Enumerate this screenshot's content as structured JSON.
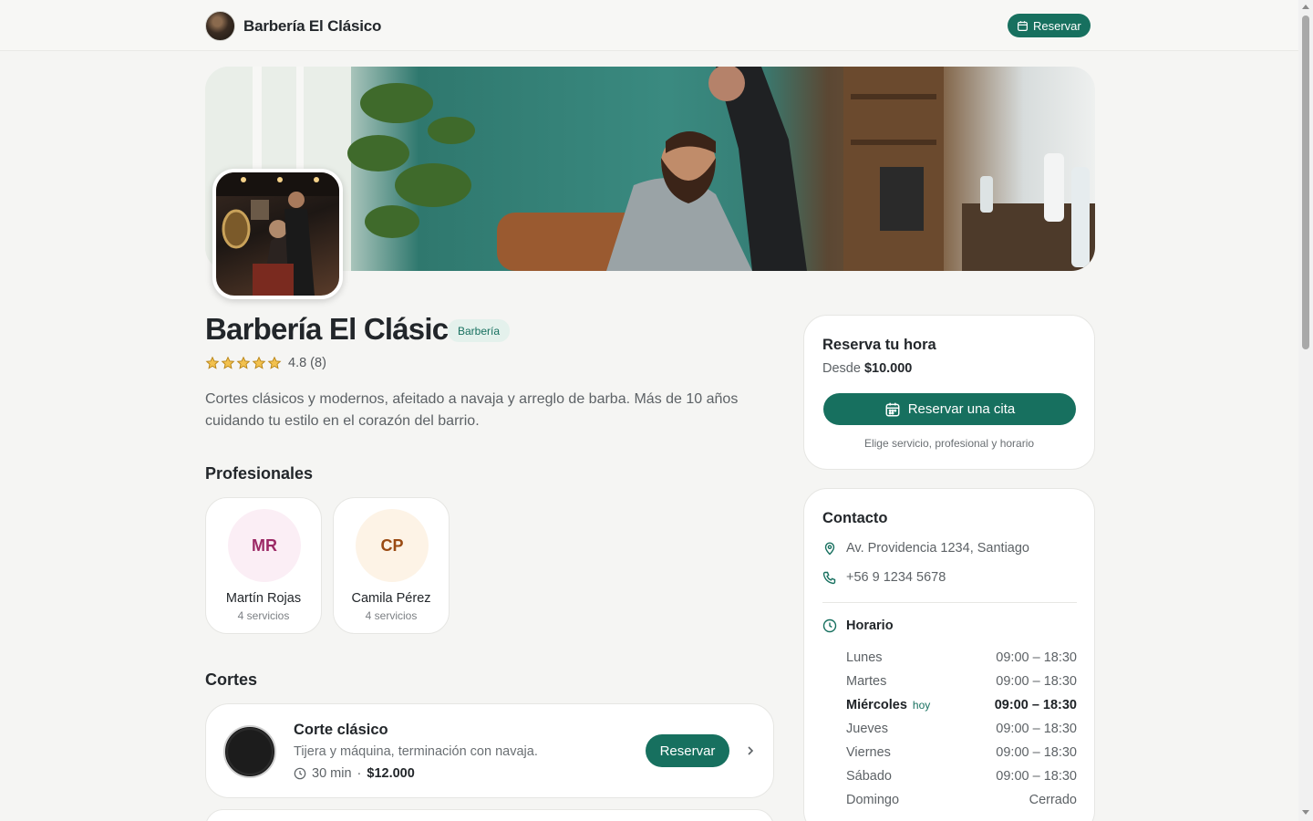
{
  "header": {
    "brand_name": "Barbería El Clásico",
    "reserve_label": "Reservar"
  },
  "shop": {
    "title": "Barbería El Clásico",
    "category": "Barbería",
    "rating_text": "4.8 (8)",
    "rating_value": 4.8,
    "rating_max": 5,
    "description": "Cortes clásicos y modernos, afeitado a navaja y arreglo de barba. Más de 10 años cuidando tu estilo en el corazón del barrio."
  },
  "professionals": {
    "title": "Profesionales",
    "items": [
      {
        "initials": "MR",
        "name": "Martín Rojas",
        "services": "4 servicios",
        "bg": "#fbeef5",
        "fg": "#9c2a66"
      },
      {
        "initials": "CP",
        "name": "Camila Pérez",
        "services": "4 servicios",
        "bg": "#fdf3e6",
        "fg": "#9a4a12"
      }
    ]
  },
  "cuts": {
    "title": "Cortes",
    "items": [
      {
        "name": "Corte clásico",
        "description": "Tijera y máquina, terminación con navaja.",
        "duration": "30 min",
        "separator": "·",
        "price": "$12.000",
        "reserve_label": "Reservar"
      }
    ]
  },
  "booking": {
    "title": "Reserva tu hora",
    "from_label": "Desde",
    "from_price": "$10.000",
    "button_label": "Reservar una cita",
    "hint": "Elige servicio, profesional y horario"
  },
  "contact": {
    "title": "Contacto",
    "address": "Av. Providencia 1234, Santiago",
    "phone": "+56 9 1234 5678",
    "hours_title": "Horario",
    "today_label": "hoy",
    "hours": [
      {
        "day": "Lunes",
        "time": "09:00 – 18:30"
      },
      {
        "day": "Martes",
        "time": "09:00 – 18:30"
      },
      {
        "day": "Miércoles",
        "time": "09:00 – 18:30"
      },
      {
        "day": "Jueves",
        "time": "09:00 – 18:30"
      },
      {
        "day": "Viernes",
        "time": "09:00 – 18:30"
      },
      {
        "day": "Sábado",
        "time": "09:00 – 18:30"
      },
      {
        "day": "Domingo",
        "time": "Cerrado"
      }
    ]
  },
  "colors": {
    "accent": "#17705f",
    "background": "#f5f5f3",
    "star": "#e0a92a"
  }
}
